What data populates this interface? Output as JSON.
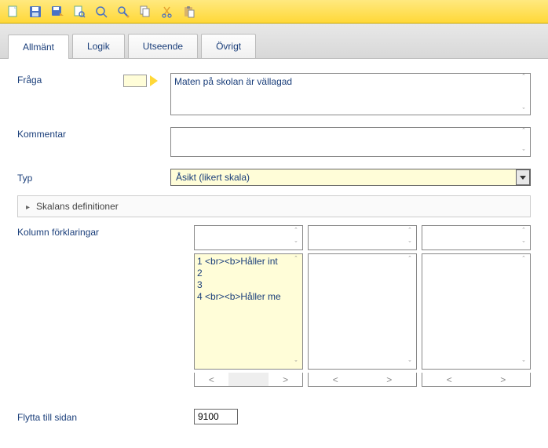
{
  "toolbar": {
    "icons": [
      "new-doc-icon",
      "save-icon",
      "save-as-icon",
      "page-find-icon",
      "zoom-icon",
      "wrench-icon",
      "copy-icon",
      "cut-icon",
      "paste-icon"
    ]
  },
  "tabs": [
    {
      "id": "allmant",
      "label": "Allmänt",
      "active": true
    },
    {
      "id": "logik",
      "label": "Logik",
      "active": false
    },
    {
      "id": "utseende",
      "label": "Utseende",
      "active": false
    },
    {
      "id": "ovrigt",
      "label": "Övrigt",
      "active": false
    }
  ],
  "labels": {
    "fraga": "Fråga",
    "kommentar": "Kommentar",
    "typ": "Typ",
    "skalans_def": "Skalans definitioner",
    "kolumn_fork": "Kolumn förklaringar",
    "flytta": "Flytta till sidan"
  },
  "values": {
    "fraga_text": "Maten på skolan är vällagad",
    "kommentar_text": "",
    "typ_selected": "Åsikt (likert skala)",
    "col1_lines": [
      "1 <br><b>Håller int",
      "2",
      "3",
      "4 <br><b>Håller me"
    ],
    "page": "9100"
  },
  "colors": {
    "accent_yellow": "#fffdd8",
    "toolbar_gradient_top": "#ffe97f",
    "toolbar_gradient_bottom": "#ffd838",
    "label_color": "#1a3e7a"
  }
}
